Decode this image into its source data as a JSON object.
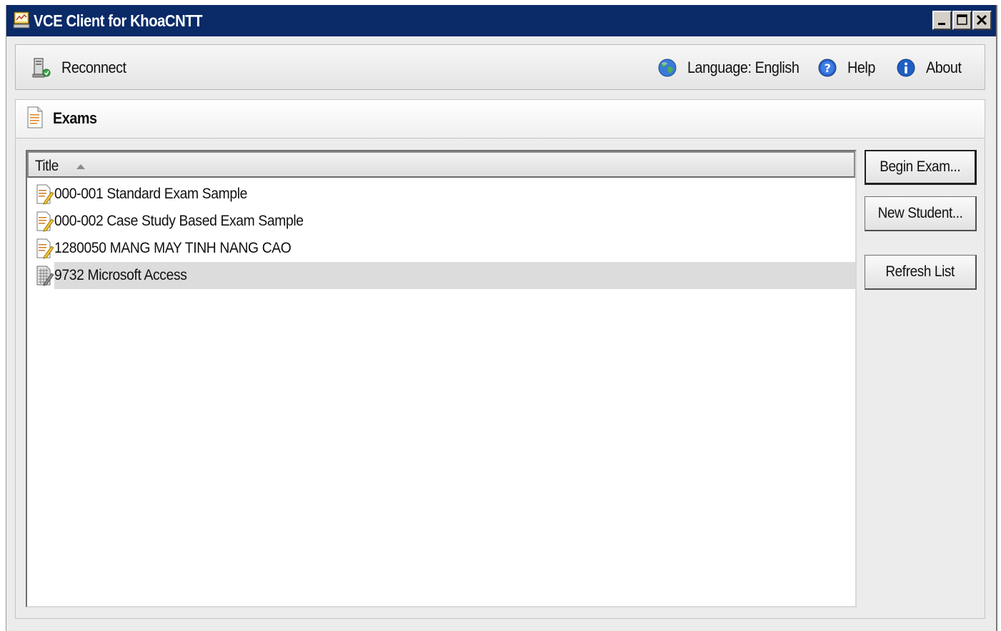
{
  "window": {
    "title": "VCE Client for KhoaCNTT"
  },
  "toolbar": {
    "reconnect_label": "Reconnect",
    "language_label": "Language: English",
    "help_label": "Help",
    "about_label": "About",
    "icons": {
      "reconnect": "computer-reconnect-icon",
      "language": "globe-icon",
      "help": "help-icon",
      "about": "info-icon"
    }
  },
  "section": {
    "title": "Exams",
    "icon": "document-icon"
  },
  "list": {
    "column_title": "Title",
    "sort": "ascending",
    "items": [
      {
        "label": "000-001 Standard Exam Sample",
        "icon": "exam-pencil-icon",
        "selected": false
      },
      {
        "label": "000-002 Case Study Based Exam Sample",
        "icon": "exam-pencil-icon",
        "selected": false
      },
      {
        "label": "1280050 MANG MAY TINH NANG CAO",
        "icon": "exam-pencil-icon",
        "selected": false
      },
      {
        "label": "9732 Microsoft Access",
        "icon": "exam-grid-icon",
        "selected": true
      }
    ]
  },
  "buttons": {
    "begin_exam": "Begin Exam...",
    "new_student": "New Student...",
    "refresh_list": "Refresh List"
  },
  "colors": {
    "titlebar": "#0a2a68",
    "selection": "#dcdcdc",
    "accent_blue": "#1f5fc4"
  }
}
